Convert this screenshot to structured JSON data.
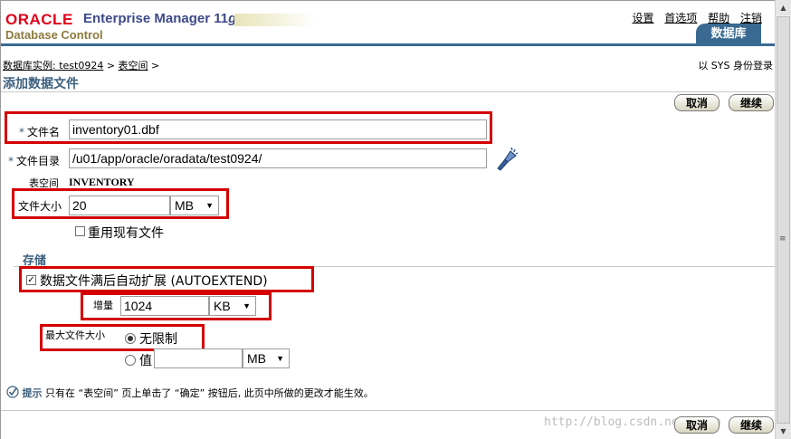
{
  "header": {
    "logo_oracle": "ORACLE",
    "logo_em": "Enterprise Manager 11",
    "logo_ver": "g",
    "logo_dc": "Database Control",
    "links": [
      "设置",
      "首选项",
      "帮助",
      "注销"
    ],
    "tab_label": "数据库"
  },
  "breadcrumb": {
    "instance": "数据库实例: test0924",
    "sep": " > ",
    "tablespace": "表空间",
    "tail": " >"
  },
  "login_as": "以 SYS 身份登录",
  "page_title": "添加数据文件",
  "buttons": {
    "cancel": "取消",
    "continue": "继续"
  },
  "form": {
    "required_mark": "*",
    "file_name_label": "文件名",
    "file_name_value": "inventory01.dbf",
    "file_dir_label": "文件目录",
    "file_dir_value": "/u01/app/oracle/oradata/test0924/",
    "tablespace_label": "表空间",
    "tablespace_value": "INVENTORY",
    "file_size_label": "文件大小",
    "file_size_value": "20",
    "file_size_unit": "MB",
    "reuse_label": "重用现有文件"
  },
  "storage": {
    "section_title": "存储",
    "autoextend_label": "数据文件满后自动扩展 (AUTOEXTEND)",
    "increment_label": "增量",
    "increment_value": "1024",
    "increment_unit": "KB",
    "max_size_label": "最大文件大小",
    "unlimited_label": "无限制",
    "value_label": "值",
    "value_value": "",
    "value_unit": "MB"
  },
  "tip": {
    "label": "提示",
    "text": " 只有在 “表空间” 页上单击了 “确定” 按钮后, 此页中所做的更改才能生效。"
  },
  "watermark": "http://blog.csdn.net/lion"
}
